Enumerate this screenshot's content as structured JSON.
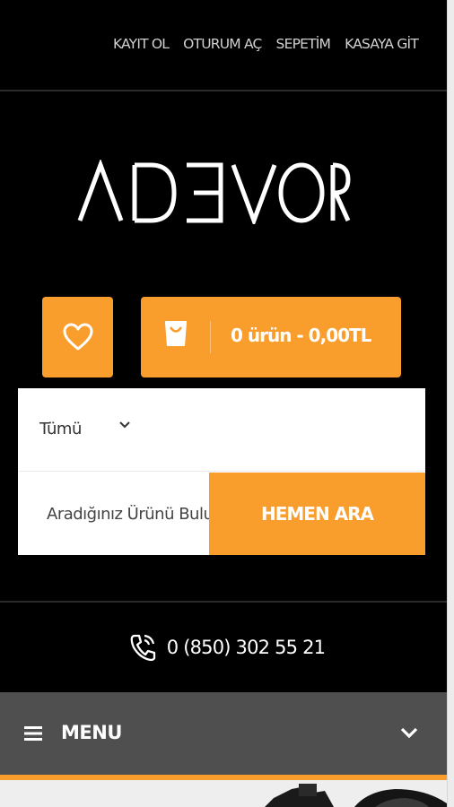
{
  "top_nav": {
    "items": [
      {
        "label": "KAYIT OL"
      },
      {
        "label": "OTURUM AÇ"
      },
      {
        "label": "SEPETİM"
      },
      {
        "label": "KASAYA GİT"
      }
    ]
  },
  "brand": {
    "logo_text": "ADEVOR"
  },
  "actions": {
    "favorites_icon": "heart-icon",
    "cart_icon": "shopping-bag-icon",
    "cart_label": "0 ürün - 0,00TL"
  },
  "search": {
    "category_selected": "Tümü",
    "placeholder": "Aradığınız Ürünü Bulun",
    "button_label": "HEMEN ARA"
  },
  "contact": {
    "phone_icon": "phone-icon",
    "phone_number": "0 (850) 302 55 21"
  },
  "menu": {
    "label": "MENU",
    "icon": "hamburger-icon",
    "toggle_icon": "chevron-down-icon"
  },
  "colors": {
    "accent": "#f99e2c",
    "background": "#000000",
    "menubar": "#4f4f4f"
  }
}
